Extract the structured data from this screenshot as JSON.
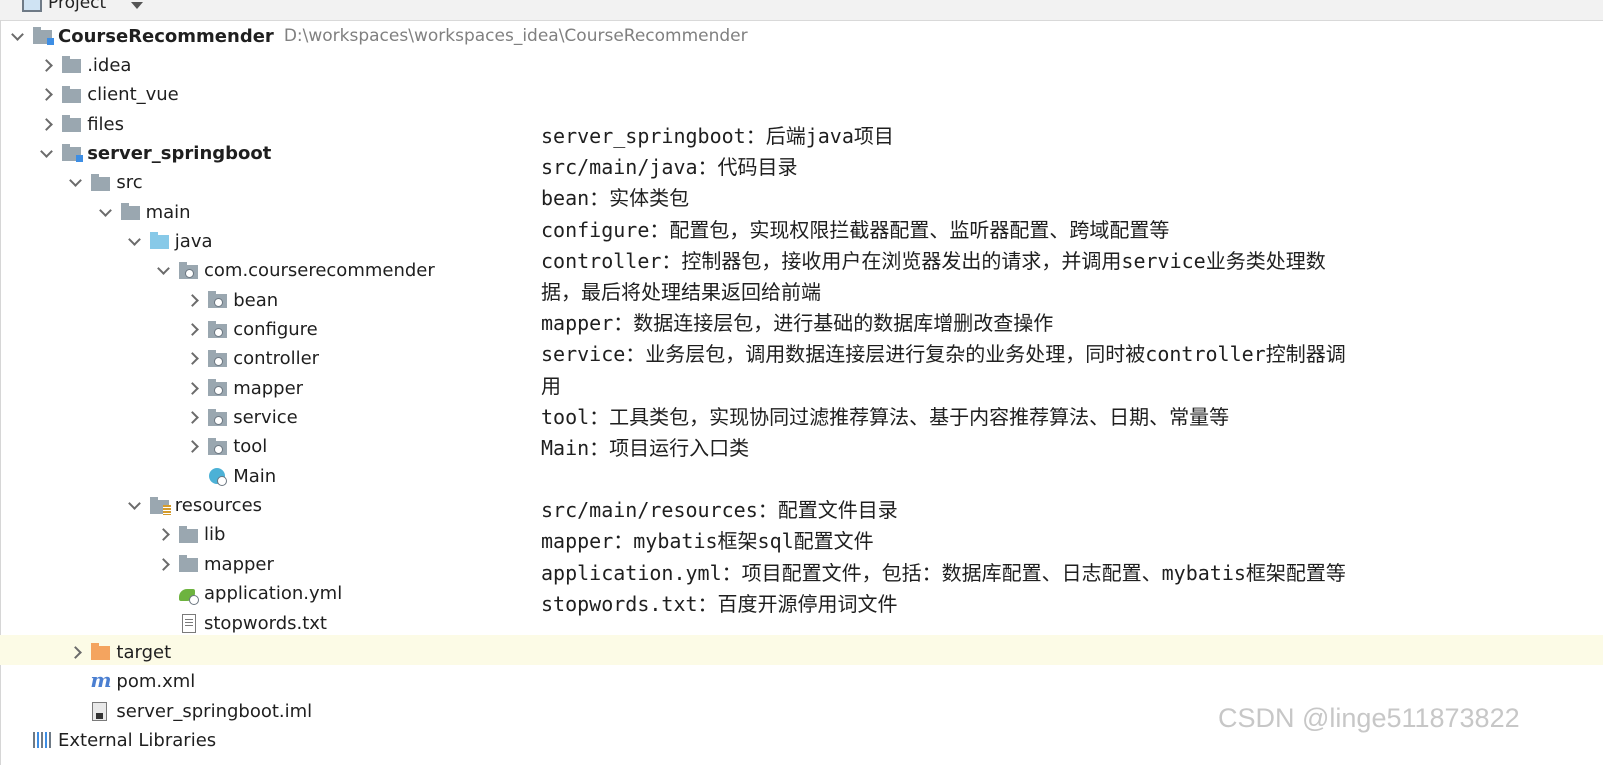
{
  "panel": {
    "title": "Project"
  },
  "tree": [
    {
      "label": "CourseRecommender",
      "path": "D:\\workspaces\\workspaces_idea\\CourseRecommender",
      "level": 0,
      "arrow": "down",
      "icon": "module-folder-icon",
      "bold": true
    },
    {
      "label": ".idea",
      "level": 1,
      "arrow": "right",
      "icon": "folder-icon"
    },
    {
      "label": "client_vue",
      "level": 1,
      "arrow": "right",
      "icon": "folder-icon"
    },
    {
      "label": "files",
      "level": 1,
      "arrow": "right",
      "icon": "folder-icon"
    },
    {
      "label": "server_springboot",
      "level": 1,
      "arrow": "down",
      "icon": "module-folder-icon",
      "bold": true
    },
    {
      "label": "src",
      "level": 2,
      "arrow": "down",
      "icon": "folder-icon"
    },
    {
      "label": "main",
      "level": 3,
      "arrow": "down",
      "icon": "folder-icon"
    },
    {
      "label": "java",
      "level": 4,
      "arrow": "down",
      "icon": "source-folder-icon"
    },
    {
      "label": "com.courserecommender",
      "level": 5,
      "arrow": "down",
      "icon": "package-icon"
    },
    {
      "label": "bean",
      "level": 6,
      "arrow": "right",
      "icon": "package-icon"
    },
    {
      "label": "configure",
      "level": 6,
      "arrow": "right",
      "icon": "package-icon"
    },
    {
      "label": "controller",
      "level": 6,
      "arrow": "right",
      "icon": "package-icon"
    },
    {
      "label": "mapper",
      "level": 6,
      "arrow": "right",
      "icon": "package-icon"
    },
    {
      "label": "service",
      "level": 6,
      "arrow": "right",
      "icon": "package-icon"
    },
    {
      "label": "tool",
      "level": 6,
      "arrow": "right",
      "icon": "package-icon"
    },
    {
      "label": "Main",
      "level": 6,
      "arrow": "none",
      "icon": "java-class-icon"
    },
    {
      "label": "resources",
      "level": 4,
      "arrow": "down",
      "icon": "resources-folder-icon"
    },
    {
      "label": "lib",
      "level": 5,
      "arrow": "right",
      "icon": "folder-icon"
    },
    {
      "label": "mapper",
      "level": 5,
      "arrow": "right",
      "icon": "folder-icon"
    },
    {
      "label": "application.yml",
      "level": 5,
      "arrow": "none",
      "icon": "spring-yml-icon"
    },
    {
      "label": "stopwords.txt",
      "level": 5,
      "arrow": "none",
      "icon": "text-file-icon"
    },
    {
      "label": "target",
      "level": 2,
      "arrow": "right",
      "icon": "excluded-folder-icon",
      "highlight": true
    },
    {
      "label": "pom.xml",
      "level": 2,
      "arrow": "none",
      "icon": "maven-icon"
    },
    {
      "label": "server_springboot.iml",
      "level": 2,
      "arrow": "none",
      "icon": "iml-file-icon"
    },
    {
      "label": "External Libraries",
      "level": 0,
      "arrow": "none",
      "icon": "libraries-icon"
    }
  ],
  "description": [
    "server_springboot：后端java项目",
    "src/main/java：代码目录",
    "bean：实体类包",
    "configure：配置包，实现权限拦截器配置、监听器配置、跨域配置等",
    "controller：控制器包，接收用户在浏览器发出的请求，并调用service业务类处理数",
    "据，最后将处理结果返回给前端",
    "mapper：数据连接层包，进行基础的数据库增删改查操作",
    "service：业务层包，调用数据连接层进行复杂的业务处理，同时被controller控制器调",
    "用",
    "tool：工具类包，实现协同过滤推荐算法、基于内容推荐算法、日期、常量等",
    "Main：项目运行入口类",
    "",
    "src/main/resources：配置文件目录",
    "mapper：mybatis框架sql配置文件",
    "application.yml：项目配置文件，包括：数据库配置、日志配置、mybatis框架配置等",
    "stopwords.txt：百度开源停用词文件"
  ],
  "watermark": "CSDN @linge511873822"
}
